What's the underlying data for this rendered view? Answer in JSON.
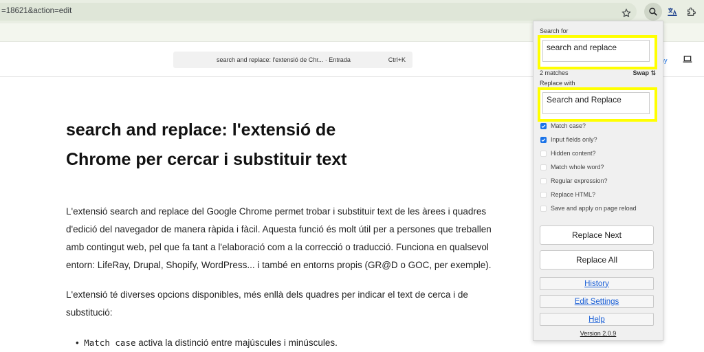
{
  "browser": {
    "url": "=18621&action=edit"
  },
  "site_header": {
    "search_text": "search and replace: l'extensió de Chr... · Entrada",
    "search_shortcut": "Ctrl+K",
    "header_link": "ny"
  },
  "article": {
    "title": "search and replace: l'extensió de Chrome per cercar i substituir text",
    "para1": "L'extensió search and replace del Google Chrome permet trobar i substituir text de les àrees i quadres d'edició del navegador de manera ràpida i fàcil. Aquesta funció és molt útil per a persones que treballen amb contingut web, pel que fa tant a l'elaboració com a la correcció o traducció. Funciona en qualsevol entorn: LifeRay, Drupal, Shopify, WordPress... i també en entorns propis (GR@D o GOC, per exemple).",
    "para2": "L'extensió té diverses opcions disponibles, més enllà dels quadres per indicar el text de cerca i de substitució:",
    "bullet_code": "Match case",
    "bullet_text": " activa la distinció entre majúscules i minúscules."
  },
  "popup": {
    "search_label": "Search for",
    "search_value": "search and replace",
    "matches": "2 matches",
    "swap": "Swap ⇅",
    "replace_label": "Replace with",
    "replace_value": "Search and Replace",
    "options": [
      {
        "label": "Match case?",
        "checked": true
      },
      {
        "label": "Input fields only?",
        "checked": true
      },
      {
        "label": "Hidden content?",
        "checked": false
      },
      {
        "label": "Match whole word?",
        "checked": false
      },
      {
        "label": "Regular expression?",
        "checked": false
      },
      {
        "label": "Replace HTML?",
        "checked": false
      },
      {
        "label": "Save and apply on page reload",
        "checked": false
      }
    ],
    "replace_next": "Replace Next",
    "replace_all": "Replace All",
    "history": "History",
    "edit_settings": "Edit Settings",
    "help": "Help",
    "version": "Version 2.0.9"
  },
  "colors": {
    "highlight": "#ffff00",
    "checkbox": "#1a73e8",
    "link": "#1a5fd6"
  },
  "icons": [
    "star-icon",
    "search-extension-icon",
    "translate-extension-icon",
    "puzzle-icon",
    "laptop-icon",
    "checkmark-icon"
  ]
}
